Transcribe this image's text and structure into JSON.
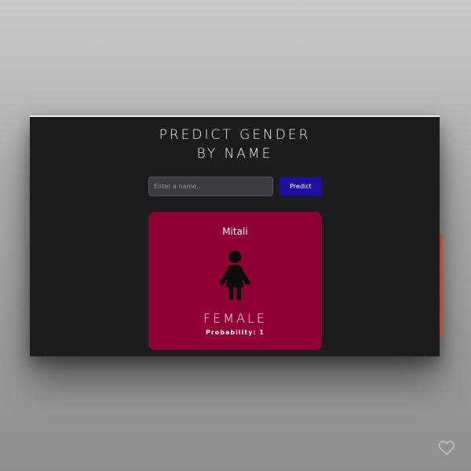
{
  "app": {
    "title_line1": "PREDICT GENDER",
    "title_line2": "BY NAME"
  },
  "search": {
    "placeholder": "Enter a name..",
    "value": "",
    "predict_label": "Predict"
  },
  "result": {
    "name": "Mitali",
    "gender": "FEMALE",
    "probability_text": "Probability: 1",
    "icon": "female-person-icon",
    "card_color": "#8f0034"
  },
  "colors": {
    "background": "#1b1c1e",
    "button": "#1f0f9e",
    "accent_strip": "#b64a3a"
  },
  "watermark": {
    "icon": "heart-icon"
  }
}
